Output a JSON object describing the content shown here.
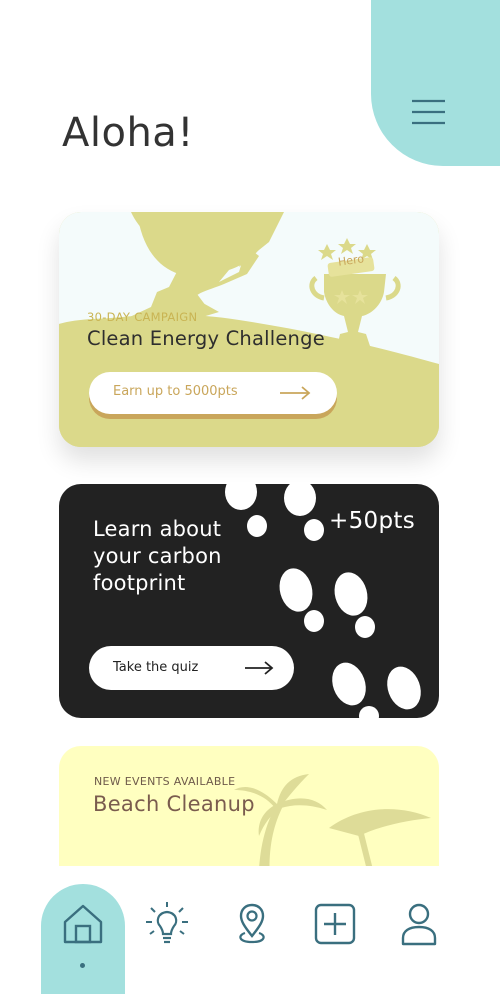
{
  "header": {
    "greeting": "Aloha!",
    "menu_icon": "hamburger-menu-icon"
  },
  "cards": {
    "campaign": {
      "tag": "30-DAY CAMPAIGN",
      "title": "Clean Energy Challenge",
      "button_label": "Earn up to 5000pts",
      "badge_text": "Hero",
      "accent": "#c9a65b",
      "background": "#dbd98a"
    },
    "quiz": {
      "title": "Learn about your carbon footprint",
      "points": "+50pts",
      "button_label": "Take the quiz",
      "background": "#222222"
    },
    "event": {
      "tag": "NEW EVENTS AVAILABLE",
      "title": "Beach Cleanup",
      "background": "#ffffc0"
    }
  },
  "bottom_nav": {
    "active": "home",
    "items": [
      "home-icon",
      "lightbulb-icon",
      "location-pin-icon",
      "add-icon",
      "profile-icon"
    ],
    "accent": "#a3e0de",
    "icon_color": "#3a6f7f"
  }
}
